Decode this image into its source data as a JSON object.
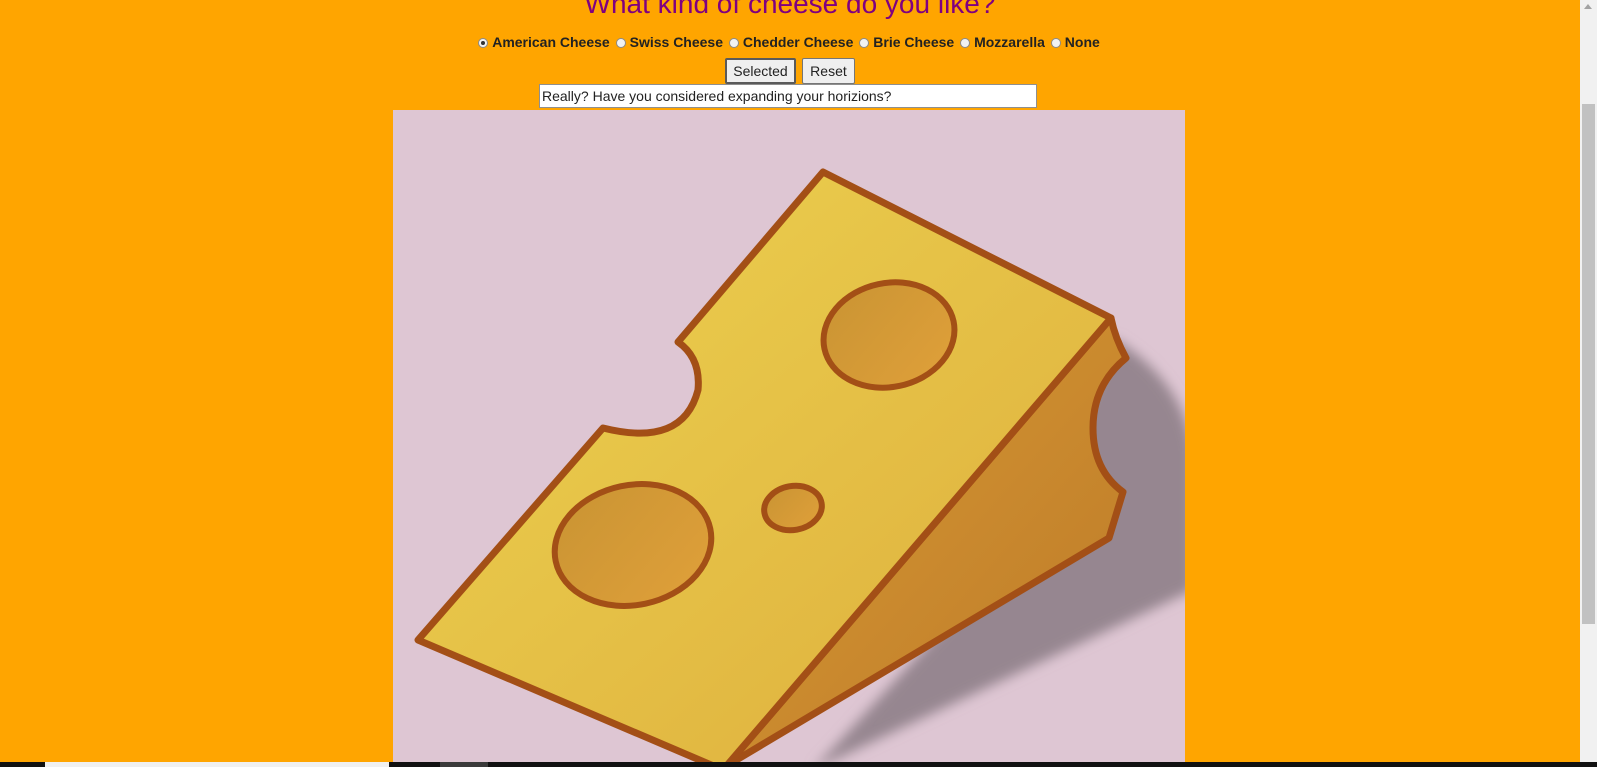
{
  "page": {
    "heading": "What kind of cheese do you like?"
  },
  "options": [
    {
      "label": "American Cheese",
      "checked": true
    },
    {
      "label": "Swiss Cheese",
      "checked": false
    },
    {
      "label": "Chedder Cheese",
      "checked": false
    },
    {
      "label": "Brie Cheese",
      "checked": false
    },
    {
      "label": "Mozzarella",
      "checked": false
    },
    {
      "label": "None",
      "checked": false
    }
  ],
  "buttons": {
    "selected_label": "Selected",
    "reset_label": "Reset"
  },
  "result": {
    "value": "Really? Have you considered expanding your horizions?"
  },
  "colors": {
    "page_background": "#FFA500",
    "heading": "#800080",
    "image_background": "#DEC6D3",
    "cheese_face": "#E8C448",
    "cheese_side": "#C98A2E",
    "cheese_outline": "#A34F16",
    "shadow": "#968690"
  }
}
